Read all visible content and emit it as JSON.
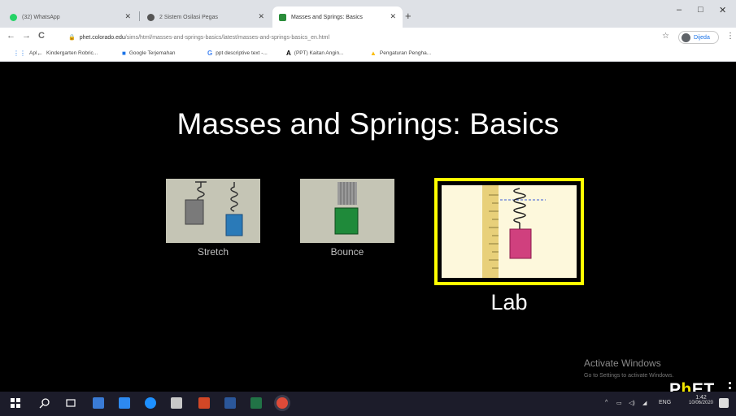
{
  "browser": {
    "tabs": [
      {
        "title": "(32) WhatsApp",
        "color": "#25d366"
      },
      {
        "title": "2 Sistem Osilasi Pegas",
        "color": "#555555"
      },
      {
        "title": "Masses and Springs: Basics",
        "color": "#2a8c3a"
      }
    ],
    "new_tab": "+",
    "window_controls": {
      "minimize": "–",
      "maximize": "□",
      "close": "✕"
    },
    "nav": {
      "back": "←",
      "forward": "→",
      "reload": "C"
    },
    "url_host": "phet.colorado.edu",
    "url_path": "/sims/html/masses-and-springs-basics/latest/masses-and-springs-basics_en.html",
    "profile_label": "Dijeda",
    "bookmarks": [
      {
        "icon": "apps-grid-icon",
        "label": "Apl"
      },
      {
        "icon": "arrow-icon",
        "label": "Kindergarten Robric..."
      },
      {
        "icon": "translate-icon",
        "label": "Google Terjemahan"
      },
      {
        "icon": "google-icon",
        "label": "ppt descriptive text -..."
      },
      {
        "icon": "a-icon",
        "label": "(PPT) Kaitan Angin..."
      },
      {
        "icon": "drive-icon",
        "label": "Pengaturan Pengha..."
      }
    ]
  },
  "sim": {
    "title": "Masses and Springs: Basics",
    "screens": [
      {
        "label": "Stretch"
      },
      {
        "label": "Bounce"
      },
      {
        "label": "Lab"
      }
    ],
    "activation": {
      "line1": "Activate Windows",
      "line2": "Go to Settings to activate Windows."
    },
    "logo": {
      "p": "P",
      "h": "h",
      "et": "ET"
    }
  },
  "taskbar": {
    "tray_language": "ENG",
    "time": "1:42",
    "date": "10/06/2020",
    "tray_caret": "^"
  },
  "colors": {
    "accent_yellow": "#ffff00",
    "phet_yellow": "#f2e600"
  }
}
